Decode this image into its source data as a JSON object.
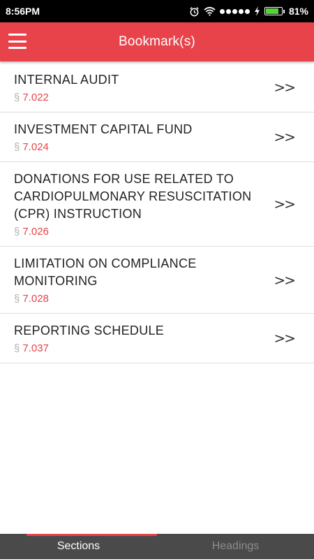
{
  "status_bar": {
    "time": "8:56PM",
    "battery_percent": "81%",
    "battery_level": 0.81,
    "icons": [
      "alarm-icon",
      "wifi-icon",
      "signal-icon",
      "charging-icon",
      "battery-icon"
    ]
  },
  "app_bar": {
    "title": "Bookmark(s)",
    "menu_icon": "hamburger-menu-icon",
    "color": "#e8434a"
  },
  "bookmarks": [
    {
      "title": "INTERNAL AUDIT",
      "section_symbol": "§",
      "section": "7.022"
    },
    {
      "title": "INVESTMENT CAPITAL FUND",
      "section_symbol": "§",
      "section": "7.024"
    },
    {
      "title": "DONATIONS FOR USE RELATED TO CARDIOPULMONARY RESUSCITATION (CPR) INSTRUCTION",
      "section_symbol": "§",
      "section": "7.026"
    },
    {
      "title": "LIMITATION ON COMPLIANCE MONITORING",
      "section_symbol": "§",
      "section": "7.028"
    },
    {
      "title": "REPORTING SCHEDULE",
      "section_symbol": "§",
      "section": "7.037"
    }
  ],
  "chevron": ">>",
  "tabs": [
    {
      "label": "Sections",
      "active": true
    },
    {
      "label": "Headings",
      "active": false
    }
  ]
}
